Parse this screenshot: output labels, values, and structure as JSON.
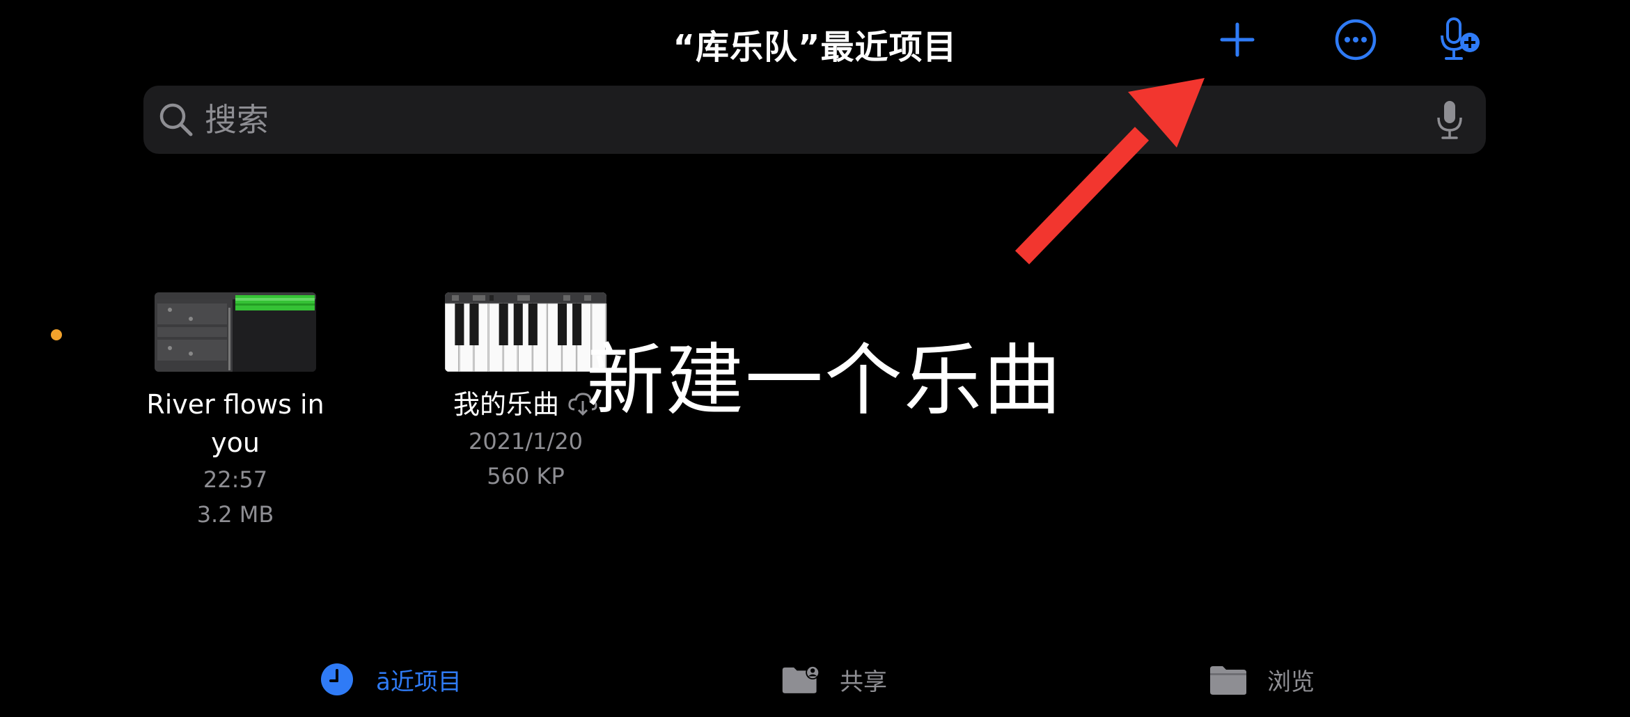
{
  "header": {
    "title": "“库乐队”最近项目",
    "actions": [
      {
        "name": "add",
        "icon": "plus-icon"
      },
      {
        "name": "more",
        "icon": "ellipsis-circle-icon"
      },
      {
        "name": "mic-add",
        "icon": "mic-plus-icon"
      }
    ]
  },
  "search": {
    "placeholder": "搜索",
    "value": ""
  },
  "projects": [
    {
      "name": "River flows in you",
      "time": "22:57",
      "size": "3.2 MB",
      "thumb": "tracks-view"
    },
    {
      "name": "我的乐曲",
      "time": "2021/1/20",
      "size": "560 KP",
      "thumb": "keyboard-view"
    }
  ],
  "overlay": {
    "caption": "新建一个乐曲"
  },
  "tabs": [
    {
      "label": "ā近项目",
      "icon": "clock-icon",
      "active": true
    },
    {
      "label": "共享",
      "icon": "shared-folder-icon",
      "active": false
    },
    {
      "label": "浏览",
      "icon": "folder-icon",
      "active": false
    }
  ],
  "colors": {
    "accent": "#2F7BF6",
    "background": "#000000",
    "searchBg": "#1C1C1E",
    "secondaryText": "#8E8E93",
    "arrow": "#F2362F",
    "statusDot": "#F2A22C"
  }
}
